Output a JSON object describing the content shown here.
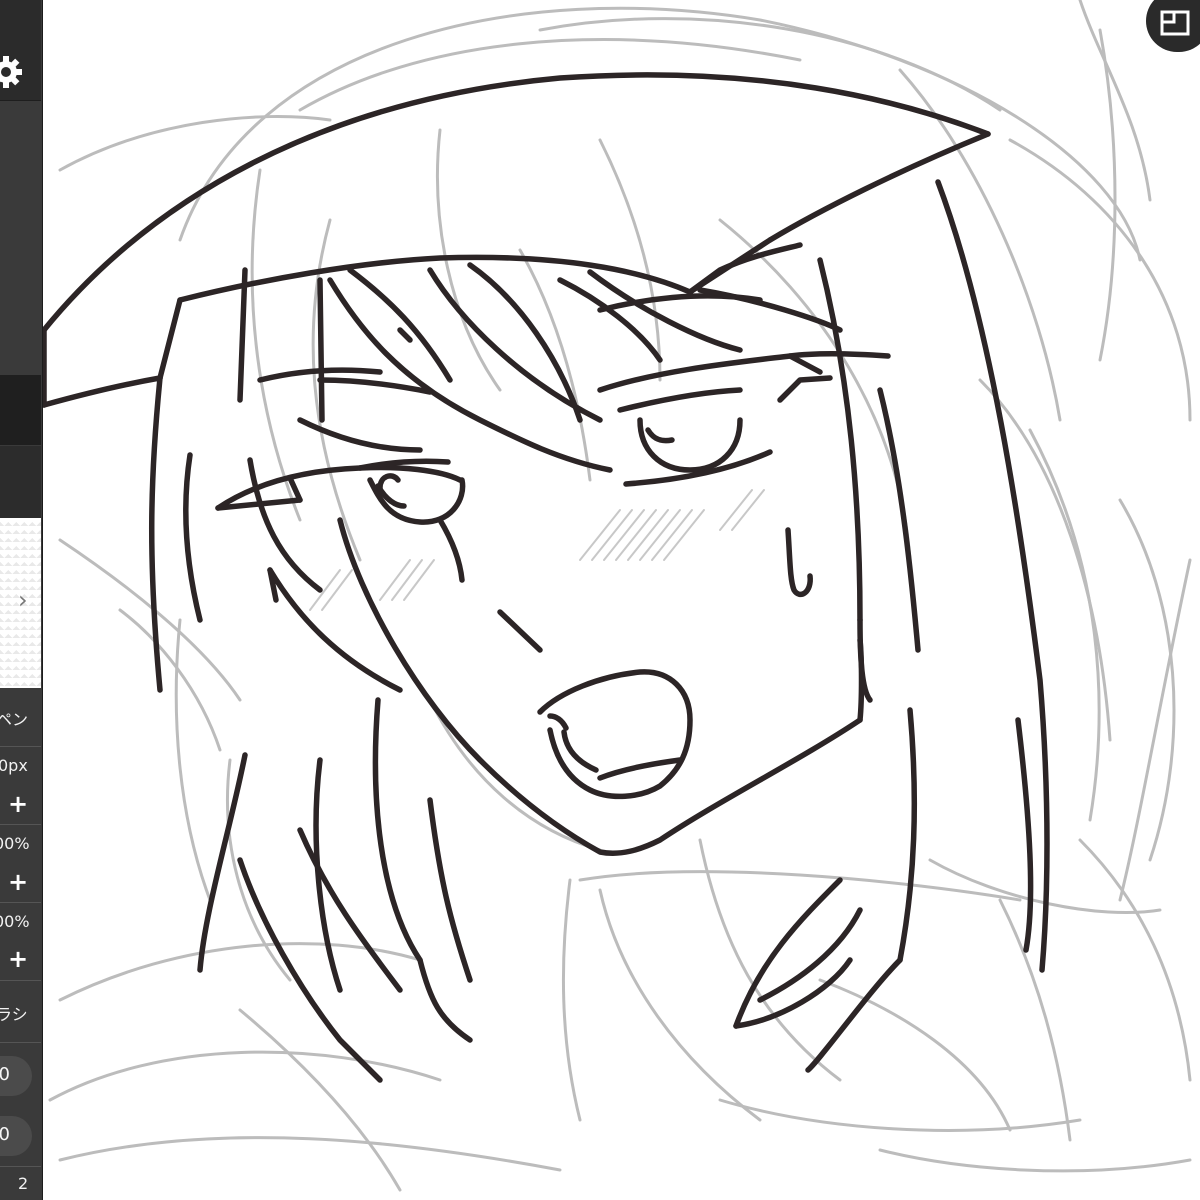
{
  "app": {
    "name": "drawing-app",
    "accent": "#3a3a3a",
    "panel_dark": "#1f1f1f"
  },
  "toolbar": {
    "settings_icon": "gear-icon",
    "next_arrow": "›",
    "brush_name": "ペン",
    "brush_size": "0px",
    "opacity_1": "00%",
    "opacity_2": "00%",
    "plus_label": "+",
    "brush_category": "ラシ",
    "pill_value_1": "0",
    "pill_value_2": "0",
    "page_number": "2"
  },
  "canvas": {
    "overview_icon": "window-icon",
    "sketch_color": "#bcbcbc",
    "lineart_color": "#2c2526"
  }
}
